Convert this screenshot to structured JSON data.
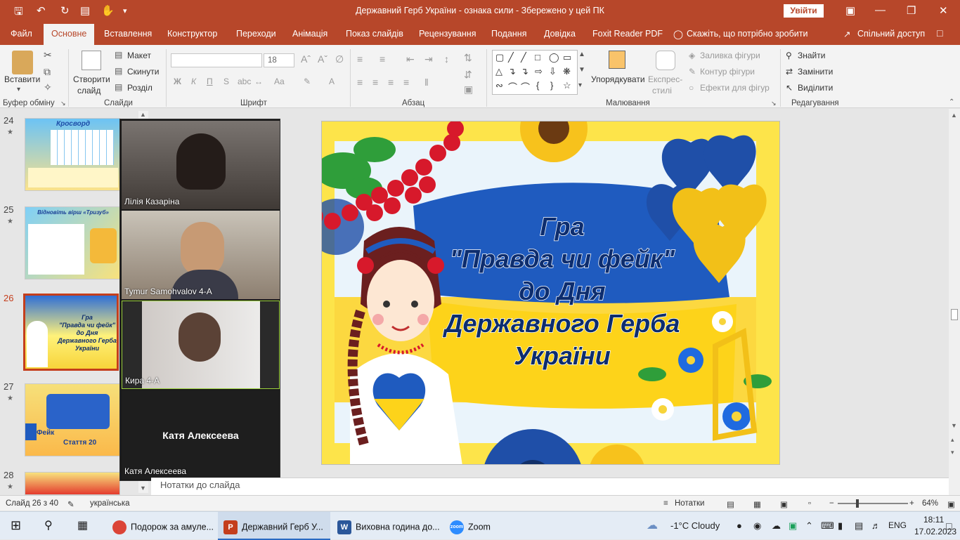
{
  "titlebar": {
    "title": "Державний Герб України - ознака сили  -  Збережено у цей ПК",
    "signin": "Увійти",
    "save_icon": "save-icon",
    "undo_icon": "undo-icon",
    "redo_icon": "redo-icon"
  },
  "menu": {
    "items": [
      "Файл",
      "Основне",
      "Вставлення",
      "Конструктор",
      "Переходи",
      "Анімація",
      "Показ слайдів",
      "Рецензування",
      "Подання",
      "Довідка",
      "Foxit Reader PDF"
    ],
    "tell_me": "Скажіть, що потрібно зробити",
    "share": "Спільний доступ"
  },
  "ribbon": {
    "clipboard": {
      "paste": "Вставити",
      "label": "Буфер обміну"
    },
    "slides": {
      "new_slide": "Створити",
      "new_slide2": "слайд",
      "layout": "Макет",
      "reset": "Скинути",
      "section": "Розділ",
      "label": "Слайди"
    },
    "font": {
      "size": "18",
      "label": "Шрифт",
      "bold": "Ж",
      "italic": "К",
      "underline": "П",
      "strike": "S",
      "case": "Aa"
    },
    "paragraph": {
      "label": "Абзац"
    },
    "drawing": {
      "arrange": "Упорядкувати",
      "quick_styles": "Експрес-",
      "quick_styles2": "стилі",
      "fill": "Заливка фігури",
      "outline": "Контур фігури",
      "effects": "Ефекти для фігур",
      "label": "Малювання"
    },
    "editing": {
      "find": "Знайти",
      "replace": "Замінити",
      "select": "Виділити",
      "label": "Редагування"
    }
  },
  "slides_pane": {
    "numbers": [
      "24",
      "25",
      "26",
      "27",
      "28"
    ],
    "current": "26",
    "thumb24_title": "Кросворд",
    "thumb25_title": "Відновіть вірш «Тризуб»",
    "thumb26_lines": [
      "Гра",
      "\"Правда чи фейк\"",
      "до Дня",
      "Державного Герба",
      "України"
    ],
    "thumb27_label": "Фейк",
    "thumb27_article": "Стаття 20"
  },
  "zoom": {
    "participants": [
      "Лілія Казаріна",
      "Tymur Samohvalov 4-A",
      "Кира 4-А",
      "Катя Алексеева"
    ],
    "center_name": "Катя Алексеева"
  },
  "slide": {
    "title_lines": [
      "Гра",
      "\"Правда чи фейк\"",
      "до Дня",
      "Державного Герба",
      "України"
    ]
  },
  "notes": {
    "placeholder": "Нотатки до слайда"
  },
  "status": {
    "slide_of": "Слайд 26 з 40",
    "language": "українська",
    "notes_btn": "Нотатки",
    "zoom": "64%"
  },
  "taskbar": {
    "items": [
      "Подорож за амуле...",
      "Державний Герб У...",
      "Виховна година до...",
      "Zoom"
    ],
    "weather": "-1°C  Cloudy",
    "lang": "ENG",
    "time": "18:11",
    "date": "17.02.2023"
  },
  "colors": {
    "accent": "#b7472a",
    "ukr_blue": "#1f5bbf",
    "ukr_yellow": "#ffd21f"
  }
}
